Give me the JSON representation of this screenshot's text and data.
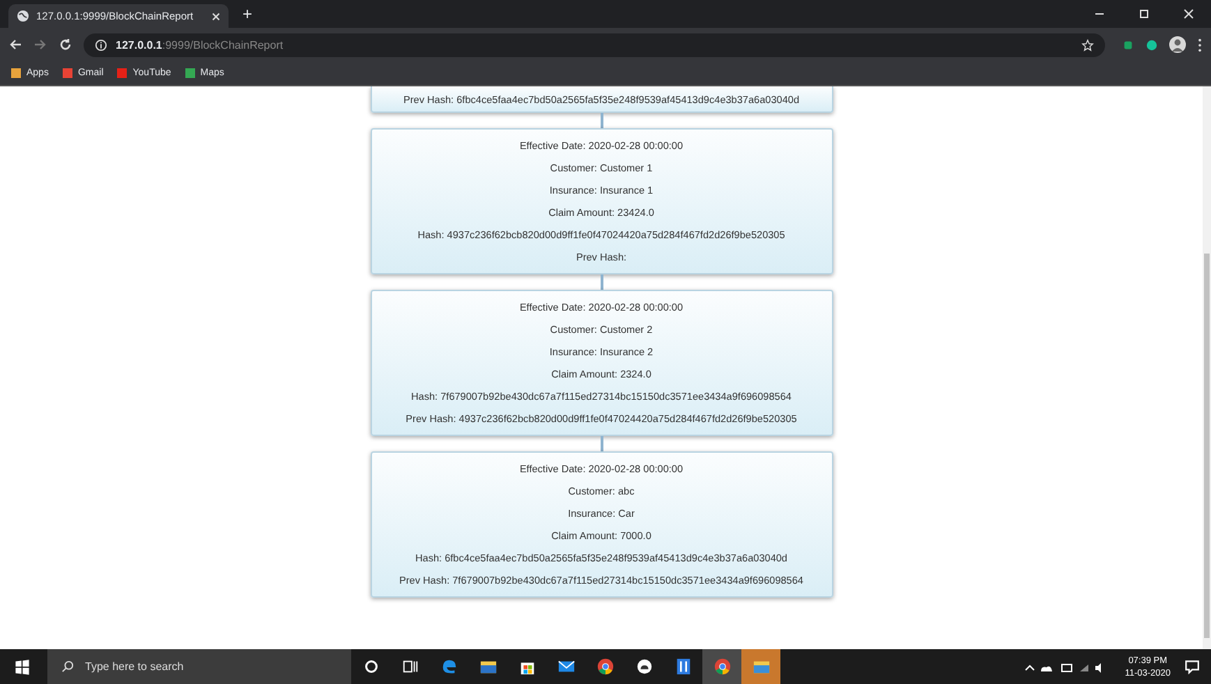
{
  "browser": {
    "tab_title": "127.0.0.1:9999/BlockChainReport",
    "new_tab": "+",
    "url_host": "127.0.0.1",
    "url_path": ":9999/BlockChainReport",
    "bookmarks": [
      {
        "kind": "apps",
        "label": "Apps"
      },
      {
        "kind": "gmail",
        "label": "Gmail"
      },
      {
        "kind": "youtube",
        "label": "YouTube"
      },
      {
        "kind": "maps",
        "label": "Maps"
      }
    ]
  },
  "blocks": [
    {
      "lines": [
        "Prev Hash: 6fbc4ce5faa4ec7bd50a2565fa5f35e248f9539af45413d9c4e3b37a6a03040d"
      ]
    },
    {
      "lines": [
        "Effective Date: 2020-02-28 00:00:00",
        "Customer: Customer 1",
        "Insurance: Insurance 1",
        "Claim Amount: 23424.0",
        "Hash: 4937c236f62bcb820d00d9ff1fe0f47024420a75d284f467fd2d26f9be520305",
        "Prev Hash:"
      ]
    },
    {
      "lines": [
        "Effective Date: 2020-02-28 00:00:00",
        "Customer: Customer 2",
        "Insurance: Insurance 2",
        "Claim Amount: 2324.0",
        "Hash: 7f679007b92be430dc67a7f115ed27314bc15150dc3571ee3434a9f696098564",
        "Prev Hash: 4937c236f62bcb820d00d9ff1fe0f47024420a75d284f467fd2d26f9be520305"
      ]
    },
    {
      "lines": [
        "Effective Date: 2020-02-28 00:00:00",
        "Customer: abc",
        "Insurance: Car",
        "Claim Amount: 7000.0",
        "Hash: 6fbc4ce5faa4ec7bd50a2565fa5f35e248f9539af45413d9c4e3b37a6a03040d",
        "Prev Hash: 7f679007b92be430dc67a7f115ed27314bc15150dc3571ee3434a9f696098564"
      ]
    }
  ],
  "taskbar": {
    "search_placeholder": "Type here to search",
    "apps": [
      {
        "kind": "circle",
        "active": false
      },
      {
        "kind": "taskview",
        "active": false
      },
      {
        "kind": "edge",
        "active": false
      },
      {
        "kind": "folder",
        "active": false
      },
      {
        "kind": "store",
        "active": false
      },
      {
        "kind": "mail",
        "active": false
      },
      {
        "kind": "chrome",
        "active": false
      },
      {
        "kind": "cloud",
        "active": false
      },
      {
        "kind": "tile",
        "active": false
      },
      {
        "kind": "chrome",
        "active": true
      },
      {
        "kind": "folder",
        "active": true
      }
    ],
    "time": "07:39 PM",
    "date": "11-03-2020"
  }
}
